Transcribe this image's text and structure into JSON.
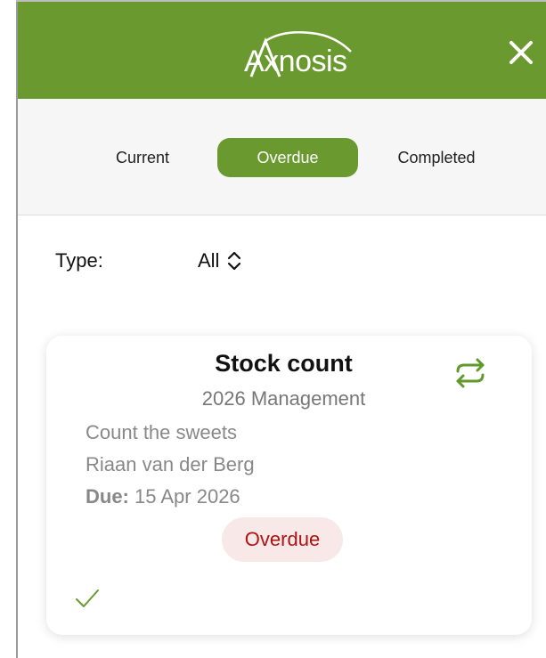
{
  "header": {
    "logo_text": "Axnosis",
    "brand_color": "#6a9a2f",
    "close_icon": "close-icon"
  },
  "tabs": {
    "items": [
      {
        "label": "Current"
      },
      {
        "label": "Overdue",
        "active": true
      },
      {
        "label": "Completed"
      }
    ]
  },
  "filter": {
    "label": "Type:",
    "value": "All",
    "icon": "chevron-up-down-icon"
  },
  "task": {
    "title": "Stock count",
    "subtitle": "2026 Management",
    "description": "Count the sweets",
    "assignee": "Riaan van der Berg",
    "due_label": "Due:",
    "due_value": " 15 Apr 2026",
    "status": "Overdue",
    "status_color": "#b01212",
    "repeat_icon": "repeat-icon",
    "check_icon": "checkmark-icon"
  }
}
